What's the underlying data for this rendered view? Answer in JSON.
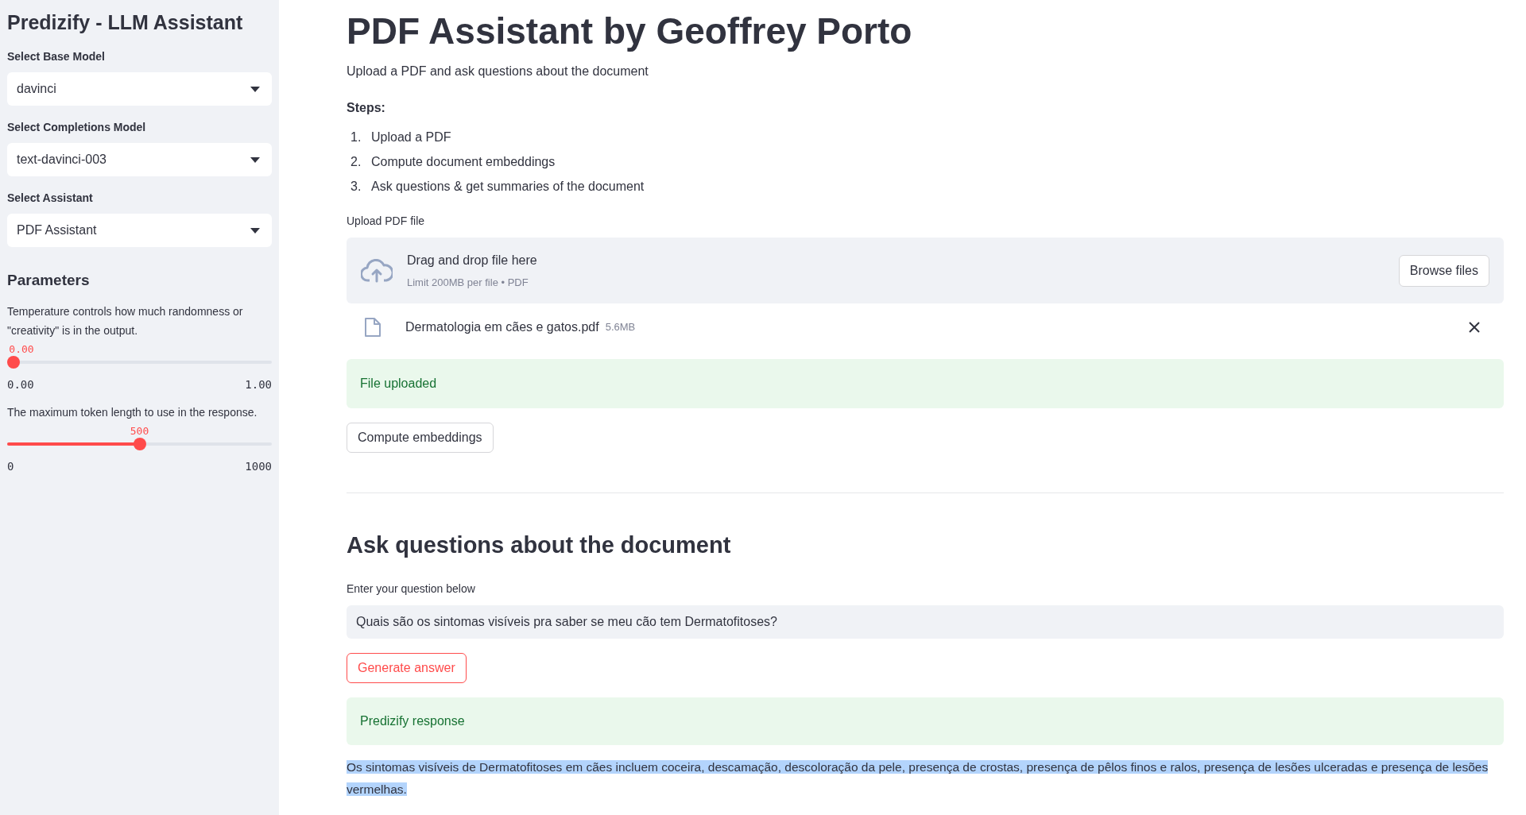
{
  "sidebar": {
    "title": "Predizify - LLM Assistant",
    "selects": [
      {
        "label": "Select Base Model",
        "value": "davinci"
      },
      {
        "label": "Select Completions Model",
        "value": "text-davinci-003"
      },
      {
        "label": "Select Assistant",
        "value": "PDF Assistant"
      }
    ],
    "parameters_heading": "Parameters",
    "sliders": [
      {
        "description": "Temperature controls how much randomness or \"creativity\" is in the output.",
        "value": "0.00",
        "level": 0,
        "min": "0.00",
        "max": "1.00"
      },
      {
        "description": "The maximum token length to use in the response.",
        "value": "500",
        "level": 0.5,
        "min": "0",
        "max": "1000"
      }
    ]
  },
  "main": {
    "title": "PDF Assistant by Geoffrey Porto",
    "subtitle": "Upload a PDF and ask questions about the document",
    "steps_heading": "Steps:",
    "steps": [
      {
        "number": "1.",
        "text": "Upload a PDF"
      },
      {
        "number": "2.",
        "text": "Compute document embeddings"
      },
      {
        "number": "3.",
        "text": "Ask questions & get summaries of the document"
      }
    ],
    "upload": {
      "label": "Upload PDF file",
      "drop_text": "Drag and drop file here",
      "limit_text": "Limit 200MB per file • PDF",
      "browse_button": "Browse files",
      "file_name": "Dermatologia em cães e gatos.pdf",
      "file_size": "5.6MB"
    },
    "upload_status": "File uploaded",
    "compute_button": "Compute embeddings",
    "question_heading": "Ask questions about the document",
    "question_label": "Enter your question below",
    "question_value": "Quais são os sintomas visíveis pra saber se meu cão tem Dermatofitoses?",
    "generate_button": "Generate answer",
    "response_status": "Predizify response",
    "response_text": "Os sintomas visíveis de Dermatofitoses em cães incluem coceira, descamação, descoloração da pele, presença de crostas, presença de pêlos finos e ralos, presença de lesões ulceradas e presença de lesões vermelhas.",
    "response_selected": true
  }
}
